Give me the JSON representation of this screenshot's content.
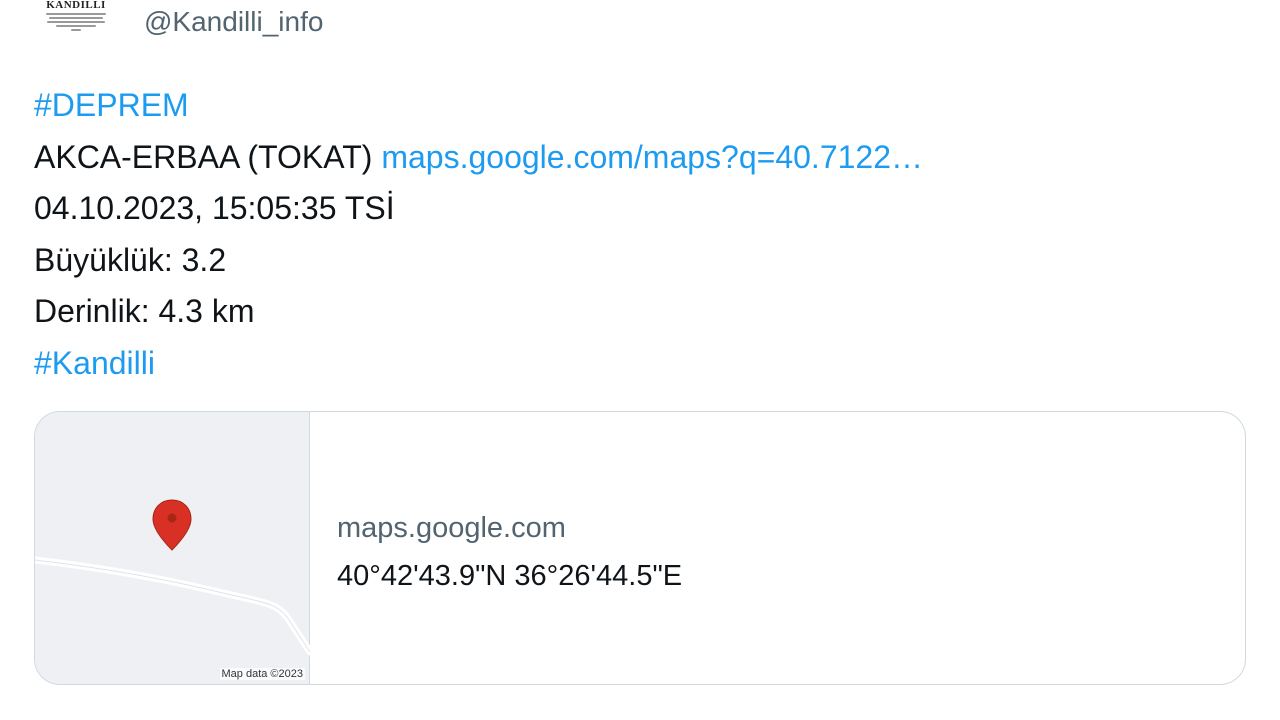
{
  "header": {
    "avatar_logo_text": "KANDILLI",
    "handle": "@Kandilli_info"
  },
  "tweet": {
    "hashtag_1": "#DEPREM",
    "location": "AKCA-ERBAA (TOKAT)",
    "map_link": "maps.google.com/maps?q=40.7122…",
    "datetime": "04.10.2023, 15:05:35 TSİ",
    "magnitude": "Büyüklük: 3.2",
    "depth": "Derinlik: 4.3 km",
    "hashtag_2": "#Kandilli"
  },
  "card": {
    "map_credit": "Map data ©2023",
    "domain": "maps.google.com",
    "title": "40°42'43.9\"N 36°26'44.5\"E"
  },
  "icons": {
    "map_pin": "map-pin-icon"
  },
  "colors": {
    "link": "#1d9bf0",
    "handle": "#536471",
    "text": "#0f1419",
    "card_border": "#cfd9de",
    "pin": "#d93025",
    "map_bg": "#eef0f3"
  }
}
